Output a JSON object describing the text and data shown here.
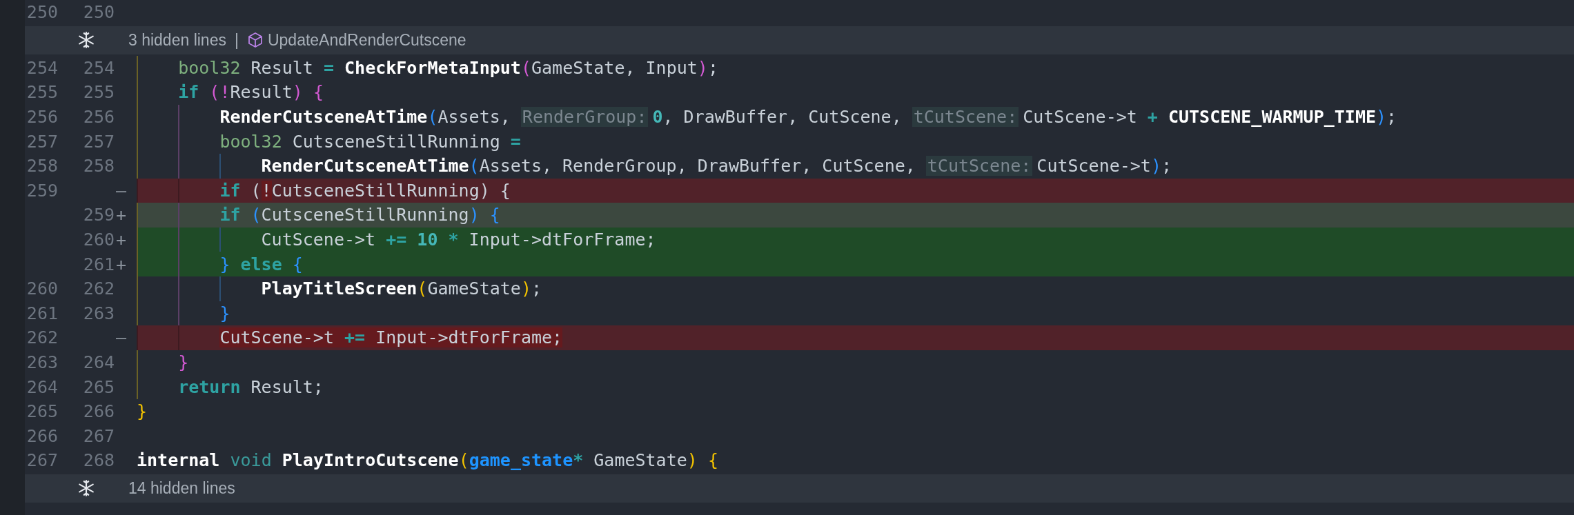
{
  "diff": [
    {
      "kind": "context",
      "old": "250",
      "new": "250"
    },
    {
      "kind": "fold",
      "label": "3 hidden lines",
      "separator": "|",
      "symbol": "UpdateAndRenderCutscene"
    },
    {
      "kind": "context",
      "old": "254",
      "new": "254",
      "guides": [
        {
          "color": "#6b6226"
        }
      ],
      "tokens": [
        {
          "t": "bool32",
          "kind": "ty"
        },
        {
          "t": " Result ",
          "kind": "p"
        },
        {
          "t": "=",
          "kind": "op"
        },
        {
          "t": " CheckForMetaInput",
          "kind": "fn"
        },
        {
          "t": "(",
          "kind": "b1"
        },
        {
          "t": "GameState, Input",
          "kind": "p"
        },
        {
          "t": ")",
          "kind": "b1"
        },
        {
          "t": ";",
          "kind": "p"
        }
      ]
    },
    {
      "kind": "context",
      "old": "255",
      "new": "255",
      "guides": [
        {
          "color": "#6b6226"
        }
      ],
      "tokens": [
        {
          "t": "if",
          "kind": "kw"
        },
        {
          "t": " (!",
          "kind": "b1"
        },
        {
          "t": "Result",
          "kind": "p"
        },
        {
          "t": ")",
          "kind": "b1"
        },
        {
          "t": " {",
          "kind": "b1"
        }
      ]
    },
    {
      "kind": "context",
      "old": "256",
      "new": "256",
      "guides": [
        {
          "color": "#6b6226"
        },
        {
          "color": "#5b3f66"
        }
      ],
      "tokens": [
        {
          "t": "RenderCutsceneAtTime",
          "kind": "fn"
        },
        {
          "t": "(",
          "kind": "b2"
        },
        {
          "t": "Assets,",
          "kind": "p"
        },
        {
          "t": "RenderGroup:",
          "kind": "hint"
        },
        {
          "t": "0",
          "kind": "num"
        },
        {
          "t": ", DrawBuffer, CutScene,",
          "kind": "p"
        },
        {
          "t": "tCutScene:",
          "kind": "hint"
        },
        {
          "t": "CutScene->t",
          "kind": "p"
        },
        {
          "t": " +",
          "kind": "op"
        },
        {
          "t": " CUTSCENE_WARMUP_TIME",
          "kind": "bd"
        },
        {
          "t": ")",
          "kind": "b2"
        },
        {
          "t": ";",
          "kind": "p"
        }
      ]
    },
    {
      "kind": "context",
      "old": "257",
      "new": "257",
      "guides": [
        {
          "color": "#6b6226"
        },
        {
          "color": "#5b3f66"
        }
      ],
      "tokens": [
        {
          "t": "bool32",
          "kind": "ty"
        },
        {
          "t": " CutsceneStillRunning ",
          "kind": "p"
        },
        {
          "t": "=",
          "kind": "op"
        }
      ]
    },
    {
      "kind": "context",
      "old": "258",
      "new": "258",
      "guides": [
        {
          "color": "#6b6226"
        },
        {
          "color": "#5b3f66"
        },
        {
          "color": "#2c4f73"
        }
      ],
      "tokens": [
        {
          "t": "RenderCutsceneAtTime",
          "kind": "fn"
        },
        {
          "t": "(",
          "kind": "b2"
        },
        {
          "t": "Assets, RenderGroup, DrawBuffer, CutScene,",
          "kind": "p"
        },
        {
          "t": "tCutScene:",
          "kind": "hint"
        },
        {
          "t": "CutScene->t",
          "kind": "p"
        },
        {
          "t": ")",
          "kind": "b2"
        },
        {
          "t": ";",
          "kind": "p"
        }
      ]
    },
    {
      "kind": "removed",
      "old": "259",
      "marker": "—",
      "guides": [
        {
          "color": "#3d1a20"
        },
        {
          "color": "#3d1a20"
        }
      ],
      "tokens": [
        {
          "t": "if",
          "kind": "kw",
          "changed": false
        },
        {
          "t": " (",
          "kind": "p",
          "changed": false
        },
        {
          "t": "!",
          "kind": "p",
          "changed": true
        },
        {
          "t": "CutsceneStillRunning) {",
          "kind": "p",
          "changed": false
        }
      ]
    },
    {
      "kind": "added",
      "muted": true,
      "new": "259",
      "marker": "+",
      "guides": [
        {
          "color": "#6b6226"
        },
        {
          "color": "#5b3f66"
        }
      ],
      "tokens": [
        {
          "t": "if",
          "kind": "kw"
        },
        {
          "t": " (",
          "kind": "b2"
        },
        {
          "t": "CutsceneStillRunning",
          "kind": "p"
        },
        {
          "t": ")",
          "kind": "b2"
        },
        {
          "t": " {",
          "kind": "b2"
        }
      ]
    },
    {
      "kind": "added",
      "muted": false,
      "new": "260",
      "marker": "+",
      "guides": [
        {
          "color": "#6b6226"
        },
        {
          "color": "#5b3f66"
        },
        {
          "color": "#2c4f73"
        }
      ],
      "tokens": [
        {
          "t": "CutScene->t ",
          "kind": "p"
        },
        {
          "t": "+=",
          "kind": "op"
        },
        {
          "t": " 10",
          "kind": "num"
        },
        {
          "t": " *",
          "kind": "op"
        },
        {
          "t": " Input->dtForFrame;",
          "kind": "p"
        }
      ]
    },
    {
      "kind": "added",
      "muted": false,
      "new": "261",
      "marker": "+",
      "guides": [
        {
          "color": "#6b6226"
        },
        {
          "color": "#5b3f66"
        }
      ],
      "tokens": [
        {
          "t": "}",
          "kind": "b2"
        },
        {
          "t": " else",
          "kind": "kw"
        },
        {
          "t": " {",
          "kind": "b2"
        }
      ]
    },
    {
      "kind": "context",
      "old": "260",
      "new": "262",
      "guides": [
        {
          "color": "#6b6226"
        },
        {
          "color": "#5b3f66"
        },
        {
          "color": "#2c4f73"
        }
      ],
      "tokens": [
        {
          "t": "PlayTitleScreen",
          "kind": "fn"
        },
        {
          "t": "(",
          "kind": "b3"
        },
        {
          "t": "GameState",
          "kind": "p"
        },
        {
          "t": ")",
          "kind": "b3"
        },
        {
          "t": ";",
          "kind": "p"
        }
      ]
    },
    {
      "kind": "context",
      "old": "261",
      "new": "263",
      "guides": [
        {
          "color": "#6b6226"
        },
        {
          "color": "#5b3f66"
        }
      ],
      "tokens": [
        {
          "t": "}",
          "kind": "b2"
        }
      ]
    },
    {
      "kind": "removed",
      "old": "262",
      "marker": "—",
      "guides": [
        {
          "color": "#3d1a20"
        },
        {
          "color": "#3d1a20"
        }
      ],
      "tokens": [
        {
          "t": "CutScene->t ",
          "kind": "p",
          "changed": true
        },
        {
          "t": "+=",
          "kind": "op",
          "changed": true
        },
        {
          "t": " Input->dtForFrame;",
          "kind": "p",
          "changed": true
        }
      ]
    },
    {
      "kind": "context",
      "old": "263",
      "new": "264",
      "guides": [
        {
          "color": "#6b6226"
        }
      ],
      "tokens": [
        {
          "t": "}",
          "kind": "b1"
        }
      ]
    },
    {
      "kind": "context",
      "old": "264",
      "new": "265",
      "guides": [
        {
          "color": "#6b6226"
        }
      ],
      "tokens": [
        {
          "t": "return",
          "kind": "kw"
        },
        {
          "t": " Result;",
          "kind": "p"
        }
      ]
    },
    {
      "kind": "context",
      "old": "265",
      "new": "266",
      "tokens": [
        {
          "t": "}",
          "kind": "b3"
        }
      ]
    },
    {
      "kind": "context",
      "old": "266",
      "new": "267"
    },
    {
      "kind": "context",
      "old": "267",
      "new": "268",
      "tokens": [
        {
          "t": "internal",
          "kind": "bd"
        },
        {
          "t": " void",
          "kind": "vd"
        },
        {
          "t": " PlayIntroCutscene",
          "kind": "fn"
        },
        {
          "t": "(",
          "kind": "b3"
        },
        {
          "t": "game_state",
          "kind": "tn"
        },
        {
          "t": "*",
          "kind": "op"
        },
        {
          "t": " GameState",
          "kind": "p"
        },
        {
          "t": ")",
          "kind": "b3"
        },
        {
          "t": " {",
          "kind": "b3"
        }
      ]
    },
    {
      "kind": "fold",
      "label": "14 hidden lines"
    }
  ]
}
